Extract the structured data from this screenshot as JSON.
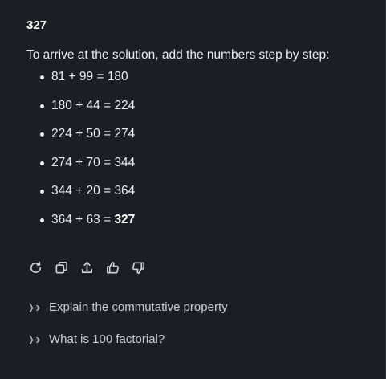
{
  "answer": {
    "title": "327",
    "intro": "To arrive at the solution, add the numbers step by step:",
    "steps": [
      {
        "expr": "81 + 99 = ",
        "result": "180",
        "bold": false
      },
      {
        "expr": "180 + 44 = ",
        "result": "224",
        "bold": false
      },
      {
        "expr": "224 + 50 = ",
        "result": "274",
        "bold": false
      },
      {
        "expr": "274 + 70 = ",
        "result": "344",
        "bold": false
      },
      {
        "expr": "344 + 20 = ",
        "result": "364",
        "bold": false
      },
      {
        "expr": "364 + 63 = ",
        "result": "327",
        "bold": true
      }
    ]
  },
  "actions": [
    {
      "icon": "regenerate-icon"
    },
    {
      "icon": "copy-icon"
    },
    {
      "icon": "share-icon"
    },
    {
      "icon": "thumbs-up-icon"
    },
    {
      "icon": "thumbs-down-icon"
    }
  ],
  "suggestions": [
    {
      "icon": "follow-up-arrow-icon",
      "label": "Explain the commutative property"
    },
    {
      "icon": "follow-up-arrow-icon",
      "label": "What is 100 factorial?"
    }
  ],
  "colors": {
    "background": "#1a1f26",
    "text": "#eceff2",
    "muted": "#c9cfd6"
  }
}
